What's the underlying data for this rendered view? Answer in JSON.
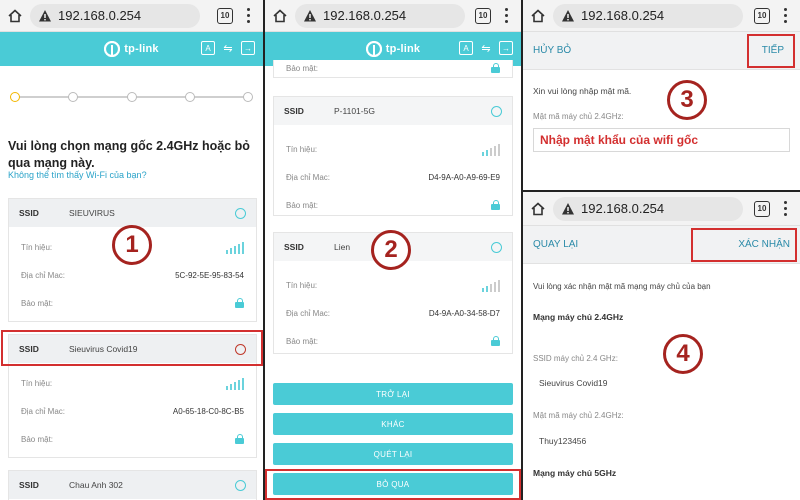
{
  "browser": {
    "url": "192.168.0.254",
    "tab_count": "10"
  },
  "brand": {
    "logo_text": "tp-link"
  },
  "colors": {
    "accent": "#4acbd6",
    "highlight": "#d32f2f",
    "badge": "#a5231f",
    "link": "#2aa3c9"
  },
  "panel1": {
    "heading": "Vui lòng chọn mạng gốc 2.4GHz hoặc bỏ qua mạng này.",
    "link": "Không thể tìm thấy Wi-Fi của bạn?",
    "labels": {
      "ssid": "SSID",
      "signal": "Tín hiệu:",
      "mac": "Địa chỉ Mac:",
      "security": "Bảo mật:"
    },
    "networks": [
      {
        "ssid": "SIEUVIRUS",
        "mac": "5C-92-5E-95-83-54"
      },
      {
        "ssid": "Sieuvirus Covid19",
        "mac": "A0-65-18-C0-8C-B5"
      },
      {
        "ssid": "Chau Anh 302",
        "mac": ""
      }
    ],
    "badge": "1"
  },
  "panel2": {
    "security_top": "Bảo mật:",
    "labels": {
      "ssid": "SSID",
      "signal": "Tín hiệu:",
      "mac": "Địa chỉ Mac:",
      "security": "Bảo mật:"
    },
    "networks": [
      {
        "ssid": "P-1101-5G",
        "mac": "D4-9A-A0-A9-69-E9"
      },
      {
        "ssid": "Lien",
        "mac": "D4-9A-A0-34-58-D7"
      }
    ],
    "buttons": {
      "back": "TRỞ LẠI",
      "other": "KHÁC",
      "rescan": "QUÉT LẠI",
      "skip": "BỎ QUA"
    },
    "badge": "2"
  },
  "panel3": {
    "cancel": "HỦY BỎ",
    "next": "TIẾP",
    "prompt": "Xin vui lòng nhập mật mã.",
    "field_label": "Mật mã máy chủ 2.4GHz:",
    "field_value": "Nhập mật khẩu của wifi gốc",
    "badge": "3"
  },
  "panel4": {
    "back": "QUAY LẠI",
    "confirm": "XÁC NHẬN",
    "prompt": "Vui lòng xác nhận mật mã mạng máy chủ của bạn",
    "section_24": "Mạng máy chủ 2.4GHz",
    "ssid_label": "SSID máy chủ 2.4 GHz:",
    "ssid_value": "Sieuvirus Covid19",
    "pwd_label": "Mật mã máy chủ 2.4GHz:",
    "pwd_value": "Thuy123456",
    "section_5": "Mạng máy chủ 5GHz",
    "badge": "4"
  }
}
